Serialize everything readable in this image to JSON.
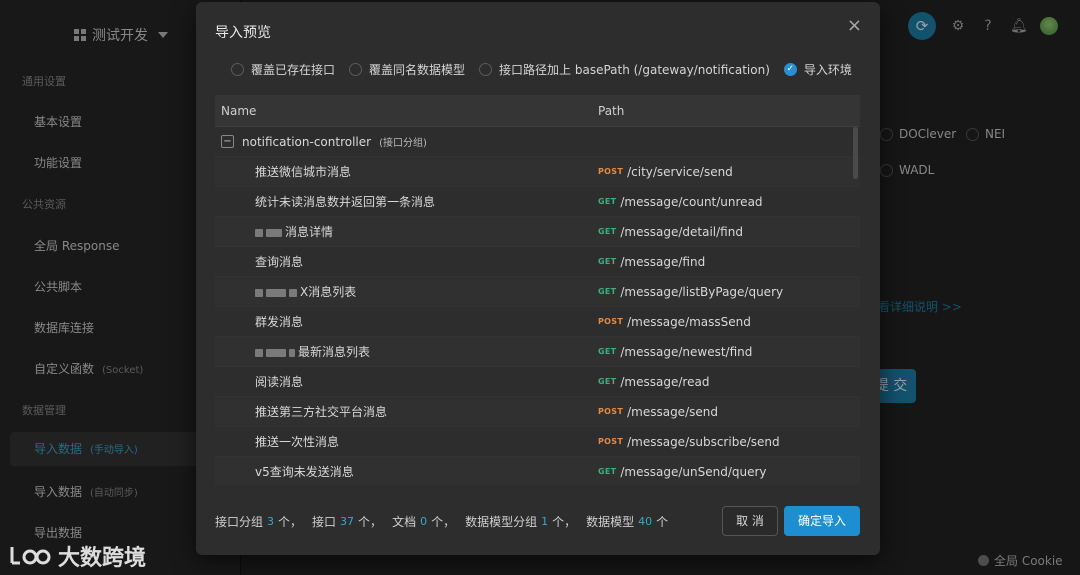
{
  "workspace": {
    "name": "测试开发"
  },
  "sidebar": {
    "sections": [
      {
        "label": "通用设置"
      },
      {
        "label": "公共资源"
      },
      {
        "label": "数据管理"
      }
    ],
    "items": [
      {
        "label": "基本设置"
      },
      {
        "label": "功能设置"
      },
      {
        "label": "全局 Response"
      },
      {
        "label": "公共脚本"
      },
      {
        "label": "数据库连接"
      },
      {
        "label": "自定义函数",
        "sub": "(Socket)"
      },
      {
        "label": "导入数据",
        "sub": "(手动导入)"
      },
      {
        "label": "导入数据",
        "sub": "(自动同步)"
      },
      {
        "label": "导出数据"
      }
    ]
  },
  "background": {
    "options": [
      "DOClever",
      "NEI",
      "WADL"
    ],
    "link_text": "看详细说明 >>",
    "submit_partial": "提 交",
    "cookie": "全局 Cookie"
  },
  "watermark": {
    "text": "大数跨境"
  },
  "modal": {
    "title": "导入预览",
    "close": "×",
    "options": [
      {
        "label": "覆盖已存在接口",
        "checked": false
      },
      {
        "label": "覆盖同名数据模型",
        "checked": false
      },
      {
        "label": "接口路径加上 basePath (/gateway/notification)",
        "checked": false
      },
      {
        "label": "导入环境",
        "checked": true
      }
    ],
    "columns": {
      "name": "Name",
      "path": "Path"
    },
    "group": {
      "name": "notification-controller",
      "tag": "(接口分组)"
    },
    "rows": [
      {
        "name": "推送微信城市消息",
        "method": "POST",
        "path": "/city/service/send"
      },
      {
        "name": "统计未读消息数并返回第一条消息",
        "method": "GET",
        "path": "/message/count/unread"
      },
      {
        "name": "消息详情",
        "method": "GET",
        "path": "/message/detail/find"
      },
      {
        "name": "查询消息",
        "method": "GET",
        "path": "/message/find"
      },
      {
        "name": "X消息列表",
        "method": "GET",
        "path": "/message/listByPage/query"
      },
      {
        "name": "群发消息",
        "method": "POST",
        "path": "/message/massSend"
      },
      {
        "name": "最新消息列表",
        "method": "GET",
        "path": "/message/newest/find"
      },
      {
        "name": "阅读消息",
        "method": "GET",
        "path": "/message/read"
      },
      {
        "name": "推送第三方社交平台消息",
        "method": "POST",
        "path": "/message/send"
      },
      {
        "name": "推送一次性消息",
        "method": "POST",
        "path": "/message/subscribe/send"
      },
      {
        "name": "v5查询未发送消息",
        "method": "GET",
        "path": "/message/unSend/query"
      }
    ],
    "footer": {
      "group_label": "接口分组",
      "group_count": "3",
      "group_unit": "个，",
      "api_label": "接口",
      "api_count": "37",
      "api_unit": "个，",
      "doc_label": "文档",
      "doc_count": "0",
      "doc_unit": "个，",
      "model_group_label": "数据模型分组",
      "model_group_count": "1",
      "model_group_unit": "个，",
      "model_label": "数据模型",
      "model_count": "40",
      "model_unit": "个"
    },
    "cancel_label": "取 消",
    "confirm_label": "确定导入"
  },
  "colors": {
    "accent": "#1d8fd1",
    "post": "#e38a43",
    "get": "#3fae7f"
  }
}
